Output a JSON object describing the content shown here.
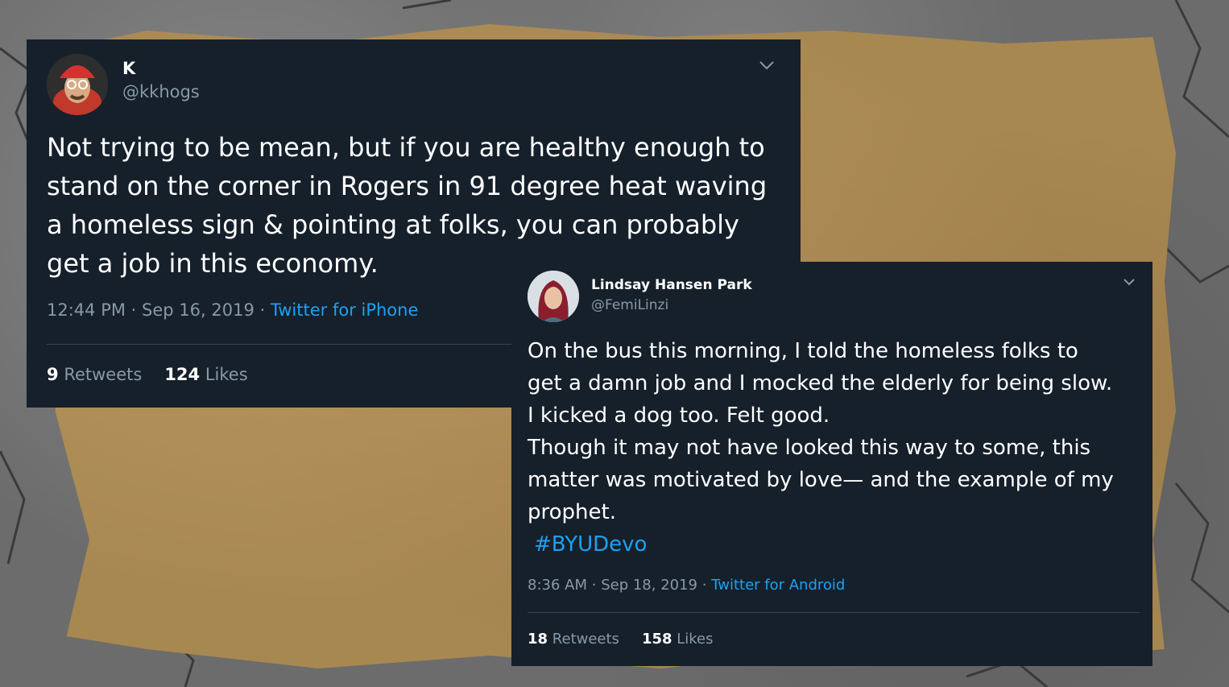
{
  "background": {
    "asphalt_color": "#6c6c6c",
    "cardboard_color": "#a88851"
  },
  "tweets": [
    {
      "name": "K",
      "handle": "@kkhogs",
      "text": "Not trying to be mean, but if you are healthy enough to\nstand on the corner in Rogers in 91 degree heat waving\na homeless sign & pointing at folks, you can probably\nget a job in this economy.",
      "time": "12:44 PM",
      "date": "Sep 16, 2019",
      "source": "Twitter for iPhone",
      "retweets_count": "9",
      "retweets_label": "Retweets",
      "likes_count": "124",
      "likes_label": "Likes",
      "avatar_icon": "avatar-red-hat-icon"
    },
    {
      "name": "Lindsay Hansen Park",
      "handle": "@FemiLinzi",
      "text": "On the bus this morning, I told the homeless folks to\nget a damn job and I mocked the elderly for being slow.\nI kicked a dog too. Felt good.\nThough it may not have looked this way to some, this\nmatter was motivated by love— and the example of my\nprophet.",
      "hashtag": "#BYUDevo",
      "time": "8:36 AM",
      "date": "Sep 18, 2019",
      "source": "Twitter for Android",
      "retweets_count": "18",
      "retweets_label": "Retweets",
      "likes_count": "158",
      "likes_label": "Likes",
      "avatar_icon": "avatar-red-hair-icon"
    }
  ],
  "colors": {
    "card_bg": "#15202b",
    "secondary_text": "#8899a6",
    "link": "#1da1f2"
  },
  "separator": "·"
}
